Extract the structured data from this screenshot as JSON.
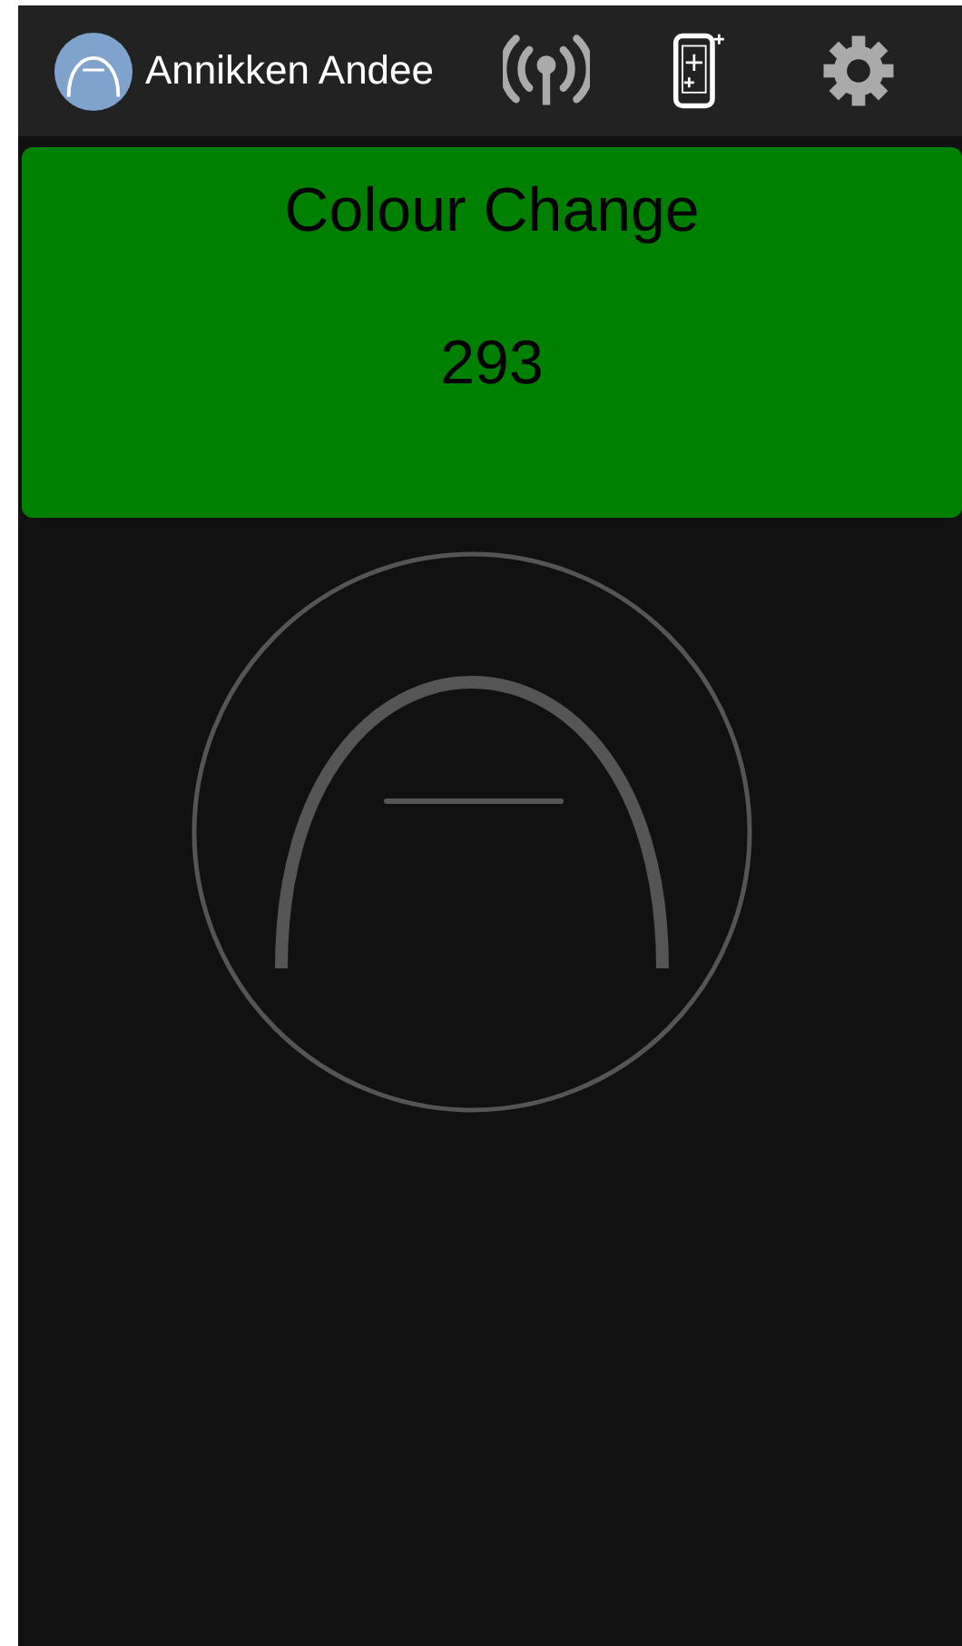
{
  "header": {
    "user_name": "Annikken Andee"
  },
  "banner": {
    "title": "Colour Change",
    "value": "293"
  }
}
